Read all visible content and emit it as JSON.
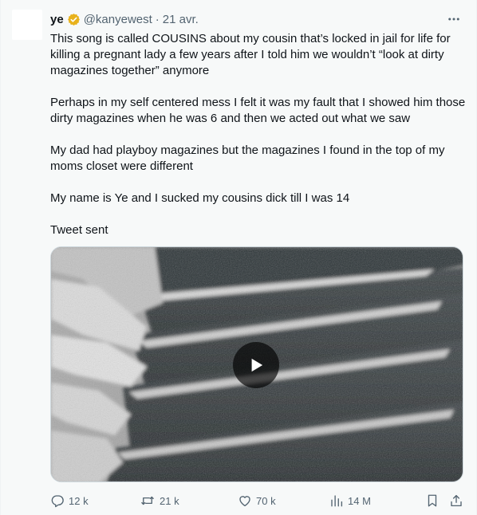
{
  "tweet": {
    "display_name": "ye",
    "handle": "@kanyewest",
    "separator": "·",
    "timestamp": "21 avr.",
    "verified_icon": "verified-badge-icon",
    "verified_color": "#e8b21c",
    "paragraphs": [
      "This song is called COUSINS about my cousin that’s locked in jail for life for killing a pregnant lady a few years after I told him we wouldn’t “look at dirty magazines together” anymore",
      "Perhaps in my self centered mess I felt it was my fault that I showed him those dirty magazines when he was 6 and then we acted out what we saw",
      "My dad had playboy magazines but the magazines I found in the top of my moms closet were different",
      "My name is Ye and I sucked my cousins dick till I was 14",
      "Tweet sent"
    ],
    "media": {
      "type": "video",
      "play_icon": "play-icon"
    }
  },
  "actions": {
    "reply": {
      "icon": "reply-icon",
      "count": "12 k"
    },
    "repost": {
      "icon": "repost-icon",
      "count": "21 k"
    },
    "like": {
      "icon": "heart-icon",
      "count": "70 k"
    },
    "views": {
      "icon": "views-icon",
      "count": "14 M"
    },
    "bookmark": {
      "icon": "bookmark-icon"
    },
    "share": {
      "icon": "share-icon"
    }
  },
  "colors": {
    "text": "#0f1419",
    "muted": "#536471",
    "background": "#f7f9f9"
  }
}
